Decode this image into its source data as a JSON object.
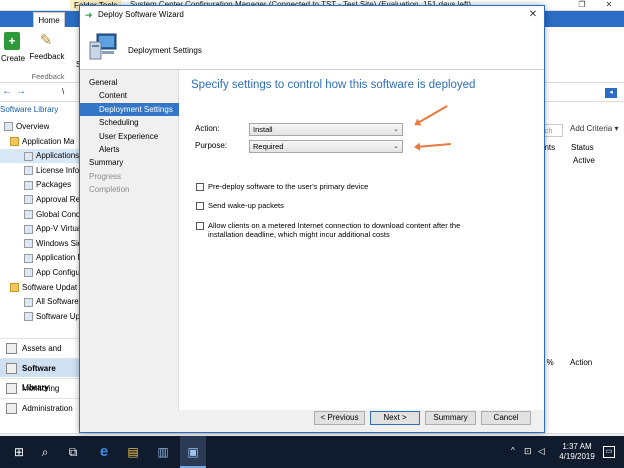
{
  "window": {
    "folder_tools": "Folder Tools",
    "title": "System Center Configuration Manager (Connected to TST - Test Site) (Evaluation, 151 days left)",
    "controls": {
      "minimize": "–",
      "restore": "❐",
      "close": "✕"
    }
  },
  "ribbon": {
    "file_tab": "",
    "home_tab": "Home",
    "create_label": "Create",
    "feedback_label": "Feedback",
    "feedback_group": "Feedback",
    "truncated_s": "S"
  },
  "address": {
    "back": "←",
    "fwd": "→",
    "slash": "\\"
  },
  "left": {
    "header": "Software Library",
    "tree": [
      {
        "label": "Overview",
        "ind": 4,
        "folder": false
      },
      {
        "label": "Application Ma",
        "ind": 10,
        "folder": true
      },
      {
        "label": "Applications",
        "ind": 24,
        "folder": false,
        "sel": true
      },
      {
        "label": "License Inform",
        "ind": 24,
        "folder": false
      },
      {
        "label": "Packages",
        "ind": 24,
        "folder": false
      },
      {
        "label": "Approval Requ",
        "ind": 24,
        "folder": false
      },
      {
        "label": "Global Conditi",
        "ind": 24,
        "folder": false
      },
      {
        "label": "App-V Virtual",
        "ind": 24,
        "folder": false
      },
      {
        "label": "Windows Side",
        "ind": 24,
        "folder": false
      },
      {
        "label": "Application M",
        "ind": 24,
        "folder": false
      },
      {
        "label": "App Configura",
        "ind": 24,
        "folder": false
      },
      {
        "label": "Software Updat",
        "ind": 10,
        "folder": true
      },
      {
        "label": "All Software U",
        "ind": 24,
        "folder": false
      },
      {
        "label": "Software Upd",
        "ind": 24,
        "folder": false
      }
    ],
    "wunderbar": [
      {
        "label": "Assets and Comp",
        "sel": false
      },
      {
        "label": "Software Library",
        "sel": true
      },
      {
        "label": "Monitoring",
        "sel": false
      },
      {
        "label": "Administration",
        "sel": false
      }
    ]
  },
  "right": {
    "search_placeholder": "arch",
    "add_criteria": "Add Criteria ▾",
    "col_ents": "ents",
    "col_status": "Status",
    "val_active": "Active",
    "col_pct": "e %",
    "col_action": "Action"
  },
  "statusbar": {
    "text": "Ready"
  },
  "taskbar": {
    "start": "⊞",
    "search": "⌕",
    "taskview": "⧉",
    "edge": "e",
    "explorer": "▤",
    "server": "▥",
    "sccm": "▣",
    "tray_up": "^",
    "tray_net": "⊡",
    "tray_vol": "◁",
    "time": "1:37 AM",
    "date": "4/19/2019",
    "notif": "▭"
  },
  "wizard": {
    "title": "Deploy Software Wizard",
    "close": "✕",
    "header": "Deployment Settings",
    "steps": [
      {
        "label": "General",
        "sub": false,
        "sel": false,
        "dis": false
      },
      {
        "label": "Content",
        "sub": true,
        "sel": false,
        "dis": false
      },
      {
        "label": "Deployment Settings",
        "sub": true,
        "sel": true,
        "dis": false
      },
      {
        "label": "Scheduling",
        "sub": true,
        "sel": false,
        "dis": false
      },
      {
        "label": "User Experience",
        "sub": true,
        "sel": false,
        "dis": false
      },
      {
        "label": "Alerts",
        "sub": true,
        "sel": false,
        "dis": false
      },
      {
        "label": "Summary",
        "sub": false,
        "sel": false,
        "dis": false
      },
      {
        "label": "Progress",
        "sub": false,
        "sel": false,
        "dis": true
      },
      {
        "label": "Completion",
        "sub": false,
        "sel": false,
        "dis": true
      }
    ],
    "heading": "Specify settings to control how this software is deployed",
    "action_label": "Action:",
    "action_value": "Install",
    "purpose_label": "Purpose:",
    "purpose_value": "Required",
    "chev": "⌄",
    "options": [
      {
        "label": "Pre-deploy software to the user's primary device",
        "checked": false
      },
      {
        "label": "Send wake-up packets",
        "checked": false
      },
      {
        "label": "Allow clients on a metered Internet connection to download content after the\ninstallation deadline, which might incur additional costs",
        "checked": false
      }
    ],
    "buttons": {
      "previous": "< Previous",
      "next": "Next >",
      "summary": "Summary",
      "cancel": "Cancel"
    }
  }
}
